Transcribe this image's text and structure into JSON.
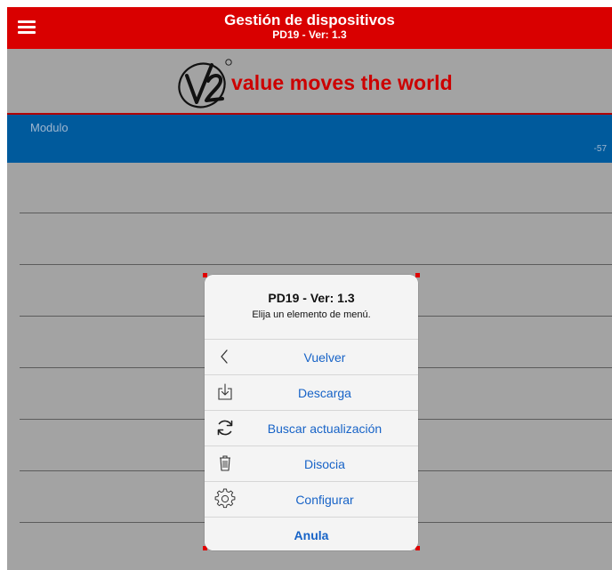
{
  "header": {
    "title": "Gestión de dispositivos",
    "subtitle": "PD19 - Ver: 1.3",
    "menu_icon": "hamburger-menu-icon"
  },
  "brand": {
    "logo_mark": "V2",
    "tagline": "value moves the world",
    "color": "#cc0000"
  },
  "module": {
    "label": "Modulo",
    "signal": "-57",
    "color": "#005a9c"
  },
  "dialog": {
    "title": "PD19 - Ver: 1.3",
    "message": "Elija un elemento de menú.",
    "items": [
      {
        "label": "Vuelver",
        "icon": "chevron-left-icon"
      },
      {
        "label": "Descarga",
        "icon": "download-icon"
      },
      {
        "label": "Buscar actualización",
        "icon": "refresh-icon"
      },
      {
        "label": "Disocia",
        "icon": "trash-icon"
      },
      {
        "label": "Configurar",
        "icon": "gear-icon"
      }
    ],
    "cancel_label": "Anula",
    "action_color": "#1763c7"
  },
  "colors": {
    "topbar": "#d90000",
    "background": "#a3a3a3"
  }
}
